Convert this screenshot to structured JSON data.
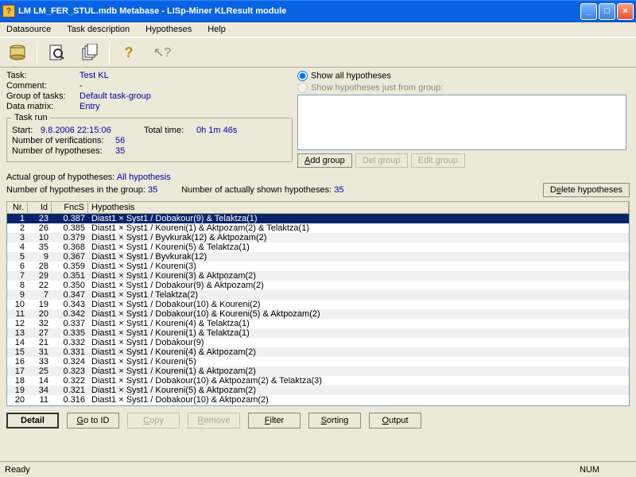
{
  "window": {
    "title": "LM LM_FER_STUL.mdb Metabase - LISp-Miner KLResult module",
    "min": "_",
    "max": "□",
    "close": "×"
  },
  "menu": [
    "Datasource",
    "Task description",
    "Hypotheses",
    "Help"
  ],
  "task": {
    "task_label": "Task:",
    "task_value": "Test KL",
    "comment_label": "Comment:",
    "comment_value": "-",
    "group_label": "Group of tasks:",
    "group_value": "Default task-group",
    "matrix_label": "Data matrix:",
    "matrix_value": "Entry"
  },
  "run": {
    "legend": "Task run",
    "start_label": "Start:",
    "start_value": "9.8.2006 22:15:06",
    "total_label": "Total time:",
    "total_value": "0h 1m 46s",
    "verif_label": "Number of verifications:",
    "verif_value": "56",
    "hyp_label": "Number of hypotheses:",
    "hyp_value": "35"
  },
  "radios": {
    "r1": "Show all hypotheses",
    "r2": "Show hypotheses just from group:"
  },
  "grpbtns": {
    "add": "Add group",
    "del": "Del group",
    "edit": "Edit group"
  },
  "section2": {
    "actual_label": "Actual group of hypotheses:",
    "actual_value": "All hypothesis",
    "ngroup_label": "Number of hypotheses in the group:",
    "ngroup_value": "35",
    "nshown_label": "Number of actually shown hypotheses:",
    "nshown_value": "35",
    "delete": "Delete hypotheses"
  },
  "cols": {
    "nr": "Nr.",
    "id": "Id",
    "fn": "FncS",
    "hy": "Hypothesis"
  },
  "rows": [
    {
      "nr": 1,
      "id": 23,
      "fn": "0.387",
      "hy": "Diast1 × Syst1 / Dobakour(9) & Telaktza(1)"
    },
    {
      "nr": 2,
      "id": 26,
      "fn": "0.385",
      "hy": "Diast1 × Syst1 / Koureni(1) & Aktpozam(2) & Telaktza(1)"
    },
    {
      "nr": 3,
      "id": 10,
      "fn": "0.379",
      "hy": "Diast1 × Syst1 / Byvkurak(12) & Aktpozam(2)"
    },
    {
      "nr": 4,
      "id": 35,
      "fn": "0.368",
      "hy": "Diast1 × Syst1 / Koureni(5) & Telaktza(1)"
    },
    {
      "nr": 5,
      "id": 9,
      "fn": "0.367",
      "hy": "Diast1 × Syst1 / Byvkurak(12)"
    },
    {
      "nr": 6,
      "id": 28,
      "fn": "0.359",
      "hy": "Diast1 × Syst1 / Koureni(3)"
    },
    {
      "nr": 7,
      "id": 29,
      "fn": "0.351",
      "hy": "Diast1 × Syst1 / Koureni(3) & Aktpozam(2)"
    },
    {
      "nr": 8,
      "id": 22,
      "fn": "0.350",
      "hy": "Diast1 × Syst1 / Dobakour(9) & Aktpozam(2)"
    },
    {
      "nr": 9,
      "id": 7,
      "fn": "0.347",
      "hy": "Diast1 × Syst1 / Telaktza(2)"
    },
    {
      "nr": 10,
      "id": 19,
      "fn": "0.343",
      "hy": "Diast1 × Syst1 / Dobakour(10) & Koureni(2)"
    },
    {
      "nr": 11,
      "id": 20,
      "fn": "0.342",
      "hy": "Diast1 × Syst1 / Dobakour(10) & Koureni(5) & Aktpozam(2)"
    },
    {
      "nr": 12,
      "id": 32,
      "fn": "0.337",
      "hy": "Diast1 × Syst1 / Koureni(4) & Telaktza(1)"
    },
    {
      "nr": 13,
      "id": 27,
      "fn": "0.335",
      "hy": "Diast1 × Syst1 / Koureni(1) & Telaktza(1)"
    },
    {
      "nr": 14,
      "id": 21,
      "fn": "0.332",
      "hy": "Diast1 × Syst1 / Dobakour(9)"
    },
    {
      "nr": 15,
      "id": 31,
      "fn": "0.331",
      "hy": "Diast1 × Syst1 / Koureni(4) & Aktpozam(2)"
    },
    {
      "nr": 16,
      "id": 33,
      "fn": "0.324",
      "hy": "Diast1 × Syst1 / Koureni(5)"
    },
    {
      "nr": 17,
      "id": 25,
      "fn": "0.323",
      "hy": "Diast1 × Syst1 / Koureni(1) & Aktpozam(2)"
    },
    {
      "nr": 18,
      "id": 14,
      "fn": "0.322",
      "hy": "Diast1 × Syst1 / Dobakour(10) & Aktpozam(2) & Telaktza(3)"
    },
    {
      "nr": 19,
      "id": 34,
      "fn": "0.321",
      "hy": "Diast1 × Syst1 / Koureni(5) & Aktpozam(2)"
    },
    {
      "nr": 20,
      "id": 11,
      "fn": "0.316",
      "hy": "Diast1 × Syst1 / Dobakour(10) & Aktpozam(2)"
    }
  ],
  "botbtns": {
    "detail": "Detail",
    "goto": "Go to ID",
    "copy": "Copy",
    "remove": "Remove",
    "filter": "Filter",
    "sort": "Sorting",
    "output": "Output"
  },
  "status": {
    "ready": "Ready",
    "num": "NUM"
  }
}
